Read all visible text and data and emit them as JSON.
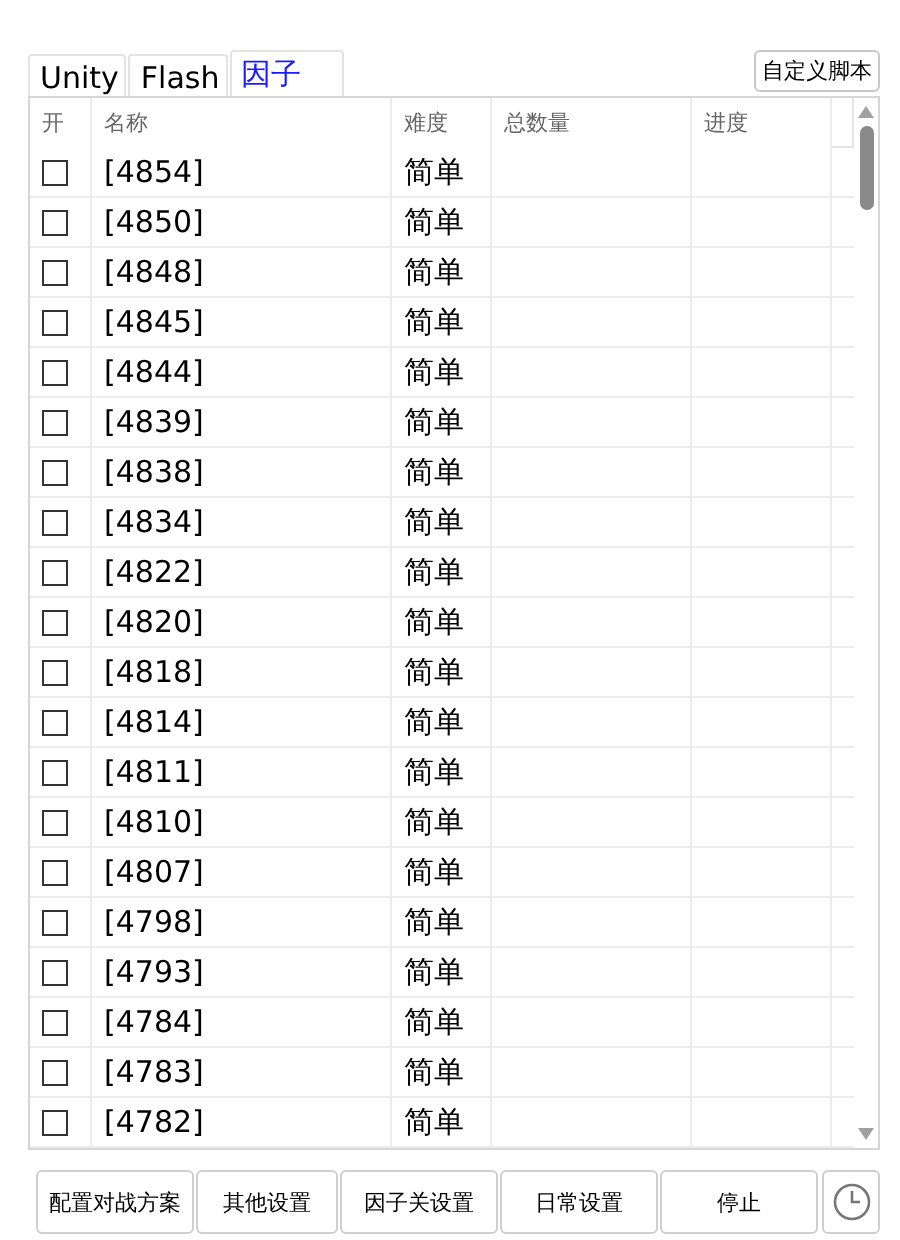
{
  "tabs": [
    {
      "label": "Unity",
      "selected": false
    },
    {
      "label": "Flash",
      "selected": false
    },
    {
      "label": "因子",
      "selected": true
    }
  ],
  "script_button": "自定义脚本",
  "table": {
    "columns": [
      "开",
      "名称",
      "难度",
      "总数量",
      "进度"
    ],
    "rows": [
      {
        "checked": false,
        "name": "[4854]",
        "difficulty": "简单"
      },
      {
        "checked": false,
        "name": "[4850]",
        "difficulty": "简单"
      },
      {
        "checked": false,
        "name": "[4848]",
        "difficulty": "简单"
      },
      {
        "checked": false,
        "name": "[4845]",
        "difficulty": "简单"
      },
      {
        "checked": false,
        "name": "[4844]",
        "difficulty": "简单"
      },
      {
        "checked": false,
        "name": "[4839]",
        "difficulty": "简单"
      },
      {
        "checked": false,
        "name": "[4838]",
        "difficulty": "简单"
      },
      {
        "checked": false,
        "name": "[4834]",
        "difficulty": "简单"
      },
      {
        "checked": false,
        "name": "[4822]",
        "difficulty": "简单"
      },
      {
        "checked": false,
        "name": "[4820]",
        "difficulty": "简单"
      },
      {
        "checked": false,
        "name": "[4818]",
        "difficulty": "简单"
      },
      {
        "checked": false,
        "name": "[4814]",
        "difficulty": "简单"
      },
      {
        "checked": false,
        "name": "[4811]",
        "difficulty": "简单"
      },
      {
        "checked": false,
        "name": "[4810]",
        "difficulty": "简单"
      },
      {
        "checked": false,
        "name": "[4807]",
        "difficulty": "简单"
      },
      {
        "checked": false,
        "name": "[4798]",
        "difficulty": "简单"
      },
      {
        "checked": false,
        "name": "[4793]",
        "difficulty": "简单"
      },
      {
        "checked": false,
        "name": "[4784]",
        "difficulty": "简单"
      },
      {
        "checked": false,
        "name": "[4783]",
        "difficulty": "简单"
      },
      {
        "checked": false,
        "name": "[4782]",
        "difficulty": "简单"
      }
    ]
  },
  "buttons": [
    "配置对战方案",
    "其他设置",
    "因子关设置",
    "日常设置",
    "停止"
  ]
}
